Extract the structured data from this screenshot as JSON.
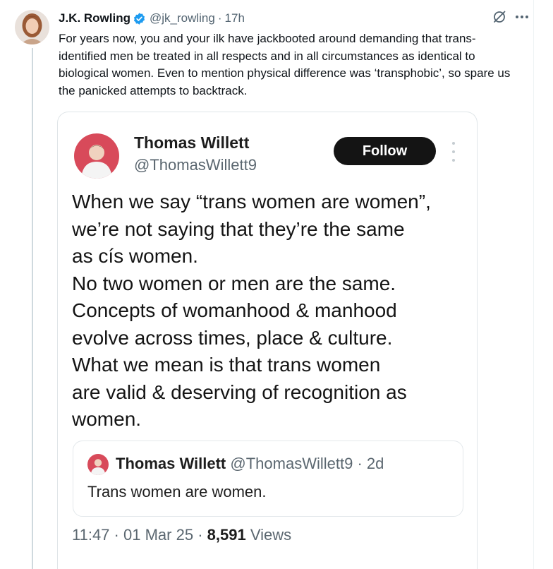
{
  "tweet": {
    "author_name": "J.K. Rowling",
    "author_handle": "@jk_rowling",
    "time_sep": "·",
    "time": "17h",
    "text": "For years now, you and your ilk have jackbooted around demanding that trans-identified men be treated in all respects and in all circumstances as identical to biological women. Even to mention physical difference was ‘transphobic’, so spare us the panicked attempts to backtrack.",
    "actions": {
      "grok_icon": "grok-icon",
      "more_icon": "more-icon"
    }
  },
  "embedded_screenshot": {
    "author_name": "Thomas Willett",
    "author_handle": "@ThomasWillett9",
    "follow_label": "Follow",
    "text_lines": [
      "When we say “trans women are women”,",
      "we’re not saying that they’re the same",
      "as cís women.",
      "No two women or men are the same.",
      "Concepts of womanhood & manhood",
      "evolve across times, place & culture.",
      "What we mean is that trans women",
      "are valid & deserving of recognition as",
      "women."
    ],
    "quote": {
      "author_name": "Thomas Willett",
      "author_handle": "@ThomasWillett9",
      "sep": "·",
      "time": "2d",
      "text": "Trans women are women."
    },
    "meta": {
      "time": "11:47",
      "sep1": "·",
      "date": "01 Mar 25",
      "sep2": "·",
      "views_count": "8,591",
      "views_label": "Views"
    }
  },
  "colors": {
    "verified_blue": "#1d9bf0",
    "follow_bg": "#141414",
    "secondary_text": "#536471",
    "thread_line": "#cfd9de"
  }
}
